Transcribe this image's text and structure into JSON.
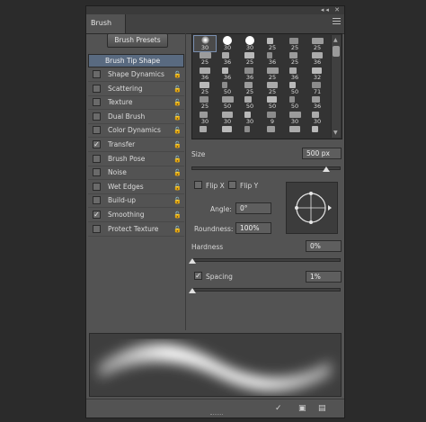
{
  "panel": {
    "tab_label": "Brush",
    "top_controls": "◂◂ ✕",
    "presets_button": "Brush Presets"
  },
  "left_options": {
    "selected": "Brush Tip Shape",
    "items": [
      {
        "label": "Shape Dynamics",
        "checked": false
      },
      {
        "label": "Scattering",
        "checked": false
      },
      {
        "label": "Texture",
        "checked": false
      },
      {
        "label": "Dual Brush",
        "checked": false
      },
      {
        "label": "Color Dynamics",
        "checked": false
      },
      {
        "label": "Transfer",
        "checked": true
      },
      {
        "label": "Brush Pose",
        "checked": false
      },
      {
        "label": "Noise",
        "checked": false
      },
      {
        "label": "Wet Edges",
        "checked": false
      },
      {
        "label": "Build-up",
        "checked": false
      },
      {
        "label": "Smoothing",
        "checked": true
      },
      {
        "label": "Protect Texture",
        "checked": false
      }
    ],
    "lock_icon": "lock-icon",
    "checkmark": "✓"
  },
  "brush_grid": {
    "rows": [
      [
        "30",
        "30",
        "30",
        "25",
        "25",
        "25"
      ],
      [
        "25",
        "36",
        "25",
        "36",
        "25",
        "36"
      ],
      [
        "36",
        "36",
        "36",
        "25",
        "36",
        "32"
      ],
      [
        "25",
        "50",
        "25",
        "25",
        "50",
        "71"
      ],
      [
        "25",
        "50",
        "50",
        "50",
        "50",
        "36"
      ],
      [
        "30",
        "30",
        "30",
        "9",
        "30",
        "30"
      ],
      [
        "",
        "",
        "",
        "",
        "",
        ""
      ]
    ],
    "selected_index": 0
  },
  "size": {
    "label": "Size",
    "value": "500 px",
    "slider_level": 0.95
  },
  "flip_x": {
    "label": "Flip X",
    "checked": false
  },
  "flip_y": {
    "label": "Flip Y",
    "checked": false
  },
  "angle": {
    "label": "Angle:",
    "value": "0°"
  },
  "roundness": {
    "label": "Roundness:",
    "value": "100%"
  },
  "hardness": {
    "label": "Hardness",
    "value": "0%",
    "slider_level": 0.0
  },
  "spacing": {
    "label": "Spacing",
    "value": "1%",
    "checked": true,
    "slider_level": 0.01
  },
  "bottom_icons": [
    "brush-edit-icon",
    "new-preset-icon",
    "trash-icon"
  ]
}
